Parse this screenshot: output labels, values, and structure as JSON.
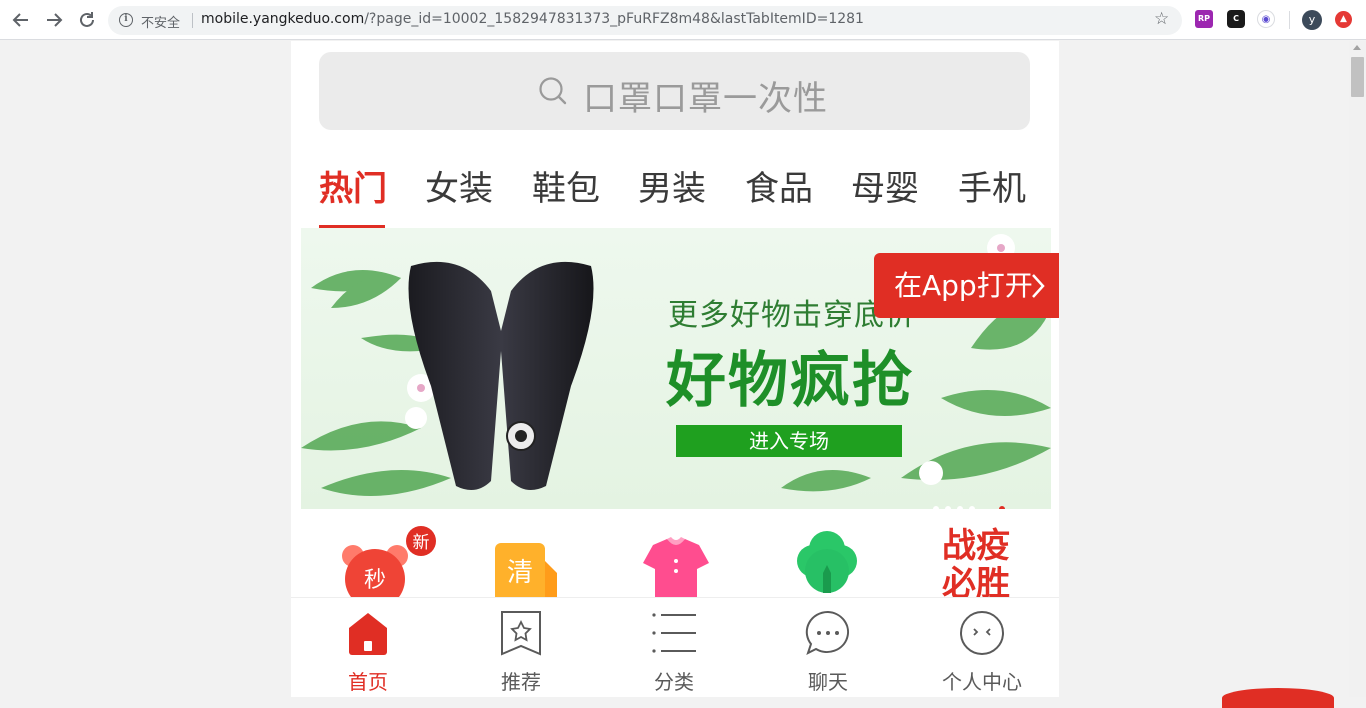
{
  "browser": {
    "insecure_label": "不安全",
    "url_host": "mobile.yangkeduo.com",
    "url_path": "/?page_id=10002_1582947831373_pFuRFZ8m48&lastTabItemID=1281",
    "profile_initial": "y",
    "extensions": [
      "RP",
      "C",
      "eye",
      "up-arrow"
    ]
  },
  "search": {
    "placeholder": "口罩口罩一次性"
  },
  "tabs": [
    {
      "label": "热门",
      "active": true
    },
    {
      "label": "女装"
    },
    {
      "label": "鞋包"
    },
    {
      "label": "男装"
    },
    {
      "label": "食品"
    },
    {
      "label": "母婴"
    },
    {
      "label": "手机"
    }
  ],
  "banner": {
    "subtitle": "更多好物击穿底价",
    "title": "好物疯抢",
    "cta": "进入专场",
    "slide_count": 6,
    "active_slide": 6
  },
  "open_app": {
    "label": "在App打开"
  },
  "quick_icons": [
    {
      "name": "flash-sale",
      "glyph": "秒",
      "badge": "新"
    },
    {
      "name": "clearance",
      "glyph": "清"
    },
    {
      "name": "clothing",
      "glyph": ""
    },
    {
      "name": "fresh-produce",
      "glyph": ""
    },
    {
      "name": "fight-epidemic",
      "glyph": "战疫 必胜"
    }
  ],
  "bottom_nav": [
    {
      "label": "首页",
      "icon": "home-icon",
      "active": true
    },
    {
      "label": "推荐",
      "icon": "recommend-icon"
    },
    {
      "label": "分类",
      "icon": "category-icon"
    },
    {
      "label": "聊天",
      "icon": "chat-icon"
    },
    {
      "label": "个人中心",
      "icon": "profile-icon"
    }
  ],
  "colors": {
    "brand_red": "#e02e24",
    "banner_green": "#1e8f28",
    "search_bg": "#ebebeb"
  }
}
